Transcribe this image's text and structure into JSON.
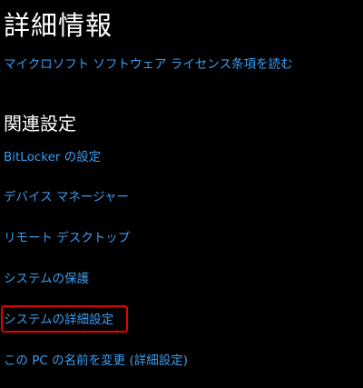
{
  "details": {
    "heading": "詳細情報",
    "license_link": "マイクロソフト ソフトウェア ライセンス条項を読む"
  },
  "related": {
    "heading": "関連設定",
    "links": [
      "BitLocker の設定",
      "デバイス マネージャー",
      "リモート デスクトップ",
      "システムの保護",
      "システムの詳細設定",
      "この PC の名前を変更 (詳細設定)"
    ]
  },
  "colors": {
    "background": "#000000",
    "heading": "#ffffff",
    "link": "#3a9df0",
    "highlight": "#e60000"
  }
}
